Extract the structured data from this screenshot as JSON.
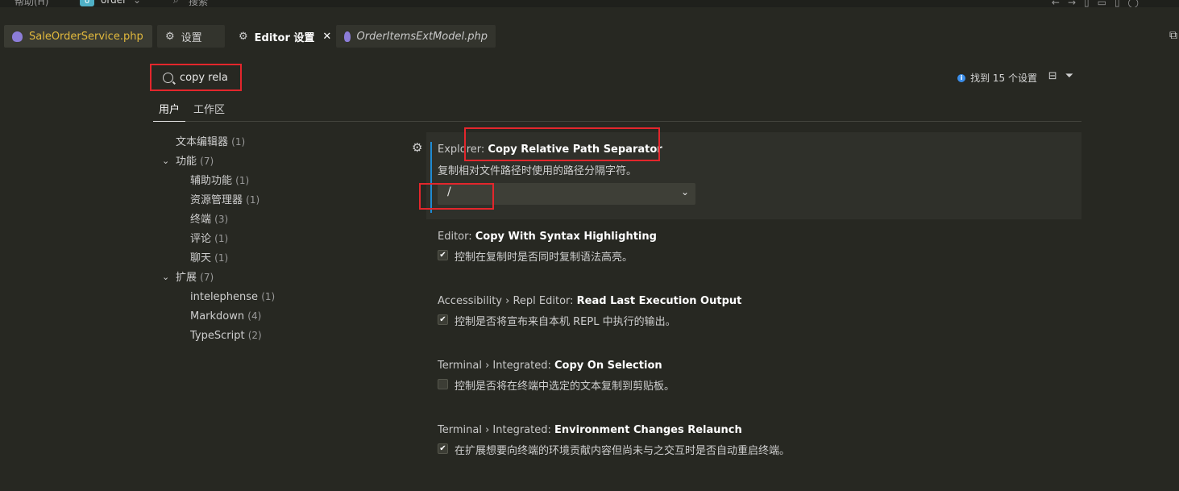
{
  "titlebar": {
    "menu_help": "帮助(H)",
    "project_badge": "0",
    "project_name": "order",
    "search_placeholder": "搜索"
  },
  "tabs": [
    {
      "label": "SaleOrderService.php"
    },
    {
      "label": "设置"
    },
    {
      "label": "Editor 设置",
      "close": "✕"
    },
    {
      "label": "OrderItemsExtModel.php"
    }
  ],
  "search": {
    "value": "copy rela"
  },
  "results": {
    "found_text": "找到 15 个设置"
  },
  "scope_tabs": {
    "user": "用户",
    "workspace": "工作区"
  },
  "toc": [
    {
      "label": "文本编辑器",
      "count": "(1)"
    },
    {
      "label": "功能",
      "count": "(7)"
    },
    {
      "label": "辅助功能",
      "count": "(1)"
    },
    {
      "label": "资源管理器",
      "count": "(1)"
    },
    {
      "label": "终端",
      "count": "(3)"
    },
    {
      "label": "评论",
      "count": "(1)"
    },
    {
      "label": "聊天",
      "count": "(1)"
    },
    {
      "label": "扩展",
      "count": "(7)"
    },
    {
      "label": "intelephense",
      "count": "(1)"
    },
    {
      "label": "Markdown",
      "count": "(4)"
    },
    {
      "label": "TypeScript",
      "count": "(2)"
    }
  ],
  "settings": [
    {
      "category": "Explorer: ",
      "name": "Copy Relative Path Separator",
      "description": "复制相对文件路径时使用的路径分隔字符。",
      "value": "/"
    },
    {
      "category": "Editor: ",
      "name": "Copy With Syntax Highlighting",
      "description": "控制在复制时是否同时复制语法高亮。",
      "checked": true
    },
    {
      "category": "Accessibility › Repl Editor: ",
      "name": "Read Last Execution Output",
      "description": "控制是否将宣布来自本机 REPL 中执行的输出。",
      "checked": true
    },
    {
      "category": "Terminal › Integrated: ",
      "name": "Copy On Selection",
      "description": "控制是否将在终端中选定的文本复制到剪贴板。",
      "checked": false
    },
    {
      "category": "Terminal › Integrated: ",
      "name": "Environment Changes Relaunch",
      "description": "在扩展想要向终端的环境贡献内容但尚未与之交互时是否自动重启终端。",
      "checked": true
    }
  ],
  "colors": {
    "highlight": "#e3262c",
    "accent": "#1f8ad2",
    "background": "#272822"
  }
}
